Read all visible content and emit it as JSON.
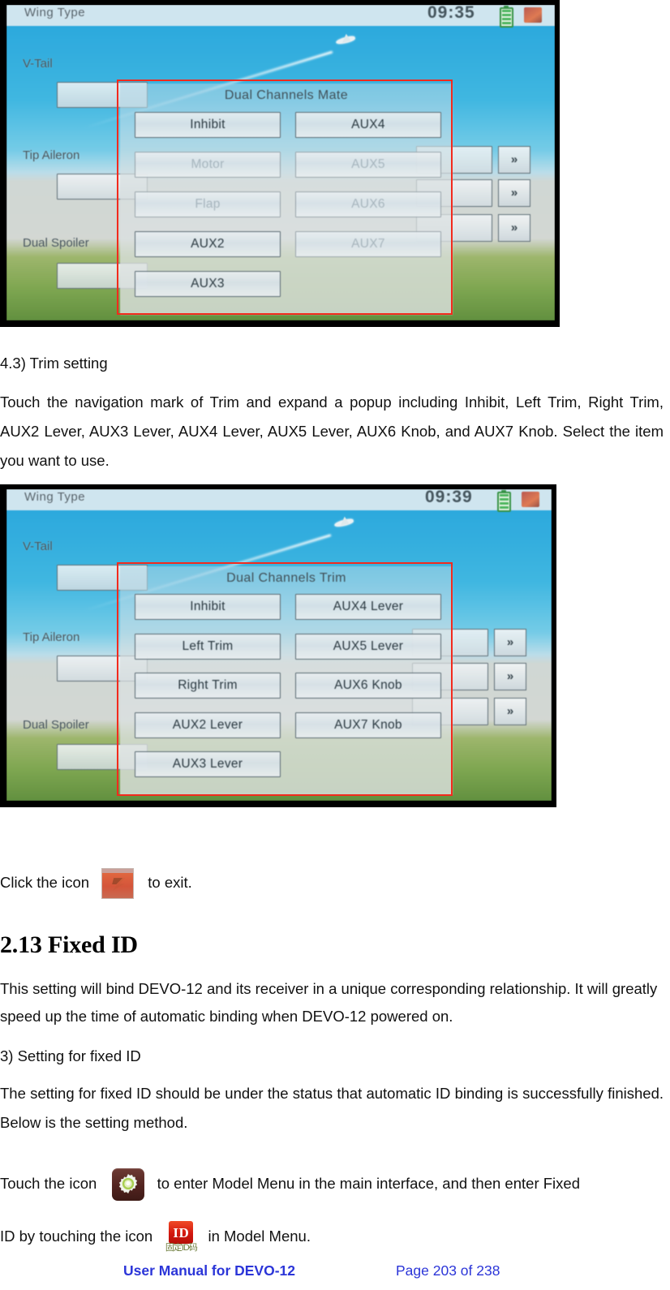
{
  "document": {
    "sections": [
      {
        "id": "trim-setting",
        "number_label": "4.3) Trim setting",
        "body": "Touch the navigation mark of Trim and expand a popup including Inhibit, Left Trim, Right Trim, AUX2 Lever, AUX3 Lever, AUX4 Lever, AUX5 Lever, AUX6 Knob, and AUX7 Knob. Select the item you want to use."
      }
    ],
    "exit_line": {
      "before": "Click the icon",
      "after": "to exit.",
      "icon": "exit-icon"
    },
    "fixed_id_heading": "2.13 Fixed ID",
    "fixed_id_body": "This setting will bind DEVO-12 and its receiver in a unique corresponding relationship. It will greatly speed up the time of automatic binding when DEVO-12 powered on.",
    "step_label": "3)    Setting for fixed ID",
    "step_body": "The setting for fixed ID should be under the status that automatic ID binding is successfully finished. Below is the setting method.",
    "touch_line": {
      "part1": "Touch the icon",
      "part2": "to enter Model Menu in the main interface, and then enter Fixed",
      "part3": "ID by touching the icon",
      "part4": "in Model Menu.",
      "gear_icon": "gear-icon",
      "id_icon": "id-icon",
      "id_icon_label": "ID",
      "id_icon_sublabel": "固定ID码"
    }
  },
  "footer": {
    "manual_title": "User Manual for DEVO-12",
    "page_label": "Page 203 of 238",
    "link_color": "#2b35d8"
  },
  "screenshots": [
    {
      "id": "dual-channels-mate",
      "status_bar": {
        "title": "Wing Type",
        "clock": "09:35",
        "battery": "battery-icon",
        "model": "model-type-icon"
      },
      "background_rows": [
        {
          "label": "V-Tail"
        },
        {
          "label": "Tip Aileron"
        },
        {
          "label": "Dual Spoiler"
        }
      ],
      "background_arrows": [
        "»",
        "»",
        "»"
      ],
      "popup": {
        "title": "Dual Channels Mate",
        "options_left": [
          {
            "label": "Inhibit",
            "dimmed": false
          },
          {
            "label": "Motor",
            "dimmed": true
          },
          {
            "label": "Flap",
            "dimmed": true
          },
          {
            "label": "AUX2",
            "dimmed": false
          },
          {
            "label": "AUX3",
            "dimmed": false
          }
        ],
        "options_right": [
          {
            "label": "AUX4",
            "dimmed": false
          },
          {
            "label": "AUX5",
            "dimmed": true
          },
          {
            "label": "AUX6",
            "dimmed": true
          },
          {
            "label": "AUX7",
            "dimmed": true
          }
        ]
      },
      "highlight_color": "#f32a1d"
    },
    {
      "id": "dual-channels-trim",
      "status_bar": {
        "title": "Wing Type",
        "clock": "09:39",
        "battery": "battery-icon",
        "model": "model-type-icon"
      },
      "background_rows": [
        {
          "label": "V-Tail"
        },
        {
          "label": "Tip Aileron"
        },
        {
          "label": "Dual Spoiler"
        }
      ],
      "background_arrows": [
        "»",
        "»",
        "»"
      ],
      "popup": {
        "title": "Dual Channels Trim",
        "options_left": [
          {
            "label": "Inhibit",
            "dimmed": false
          },
          {
            "label": "Left Trim",
            "dimmed": false
          },
          {
            "label": "Right Trim",
            "dimmed": false
          },
          {
            "label": "AUX2 Lever",
            "dimmed": false
          },
          {
            "label": "AUX3 Lever",
            "dimmed": false
          }
        ],
        "options_right": [
          {
            "label": "AUX4 Lever",
            "dimmed": false
          },
          {
            "label": "AUX5 Lever",
            "dimmed": false
          },
          {
            "label": "AUX6 Knob",
            "dimmed": false
          },
          {
            "label": "AUX7 Knob",
            "dimmed": false
          }
        ]
      },
      "highlight_color": "#f32a1d"
    }
  ]
}
